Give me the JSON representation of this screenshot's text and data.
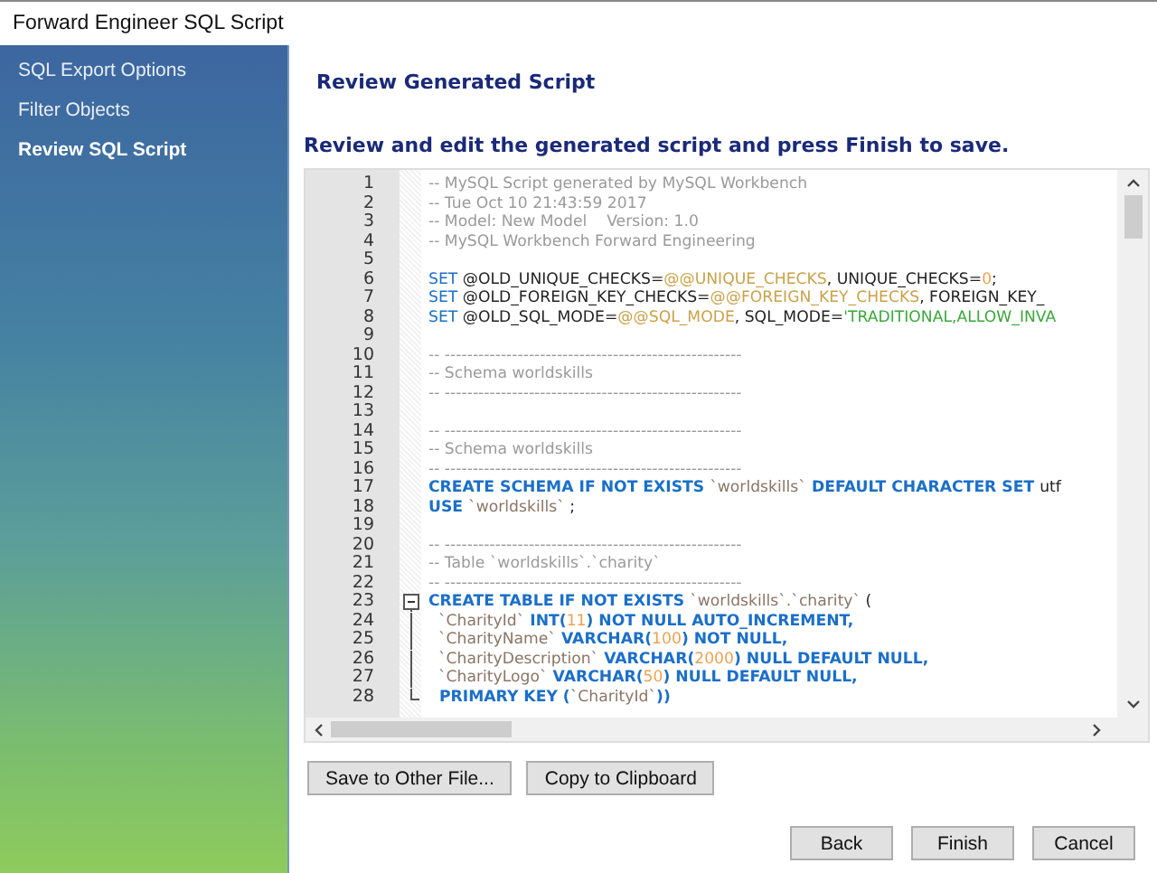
{
  "window": {
    "title": "Forward Engineer SQL Script"
  },
  "sidebar": {
    "items": [
      {
        "label": "SQL Export Options",
        "selected": false
      },
      {
        "label": "Filter Objects",
        "selected": false
      },
      {
        "label": "Review SQL Script",
        "selected": true
      }
    ]
  },
  "page": {
    "heading": "Review Generated Script",
    "instruction": "Review and edit the generated script and press Finish to save."
  },
  "editor": {
    "lines": [
      {
        "number": "1",
        "kind": "plain",
        "tokens": [
          {
            "kind": "comment",
            "text": "-- MySQL Script generated by MySQL Workbench"
          }
        ]
      },
      {
        "number": "2",
        "kind": "plain",
        "tokens": [
          {
            "kind": "comment",
            "text": "-- Tue Oct 10 21:43:59 2017"
          }
        ]
      },
      {
        "number": "3",
        "kind": "plain",
        "tokens": [
          {
            "kind": "comment",
            "text": "-- Model: New Model    Version: 1.0"
          }
        ]
      },
      {
        "number": "4",
        "kind": "plain",
        "tokens": [
          {
            "kind": "comment",
            "text": "-- MySQL Workbench Forward Engineering"
          }
        ]
      },
      {
        "number": "5",
        "kind": "plain"
      },
      {
        "number": "6",
        "kind": "plain",
        "tokens": [
          {
            "kind": "command",
            "text": "SET"
          },
          {
            "kind": "text",
            "text": " @OLD_UNIQUE_CHECKS="
          },
          {
            "kind": "variable",
            "text": "@@UNIQUE_CHECKS"
          },
          {
            "kind": "text",
            "text": ", UNIQUE_CHECKS="
          },
          {
            "kind": "number",
            "text": "0"
          },
          {
            "kind": "text",
            "text": ";"
          }
        ]
      },
      {
        "number": "7",
        "kind": "plain",
        "tokens": [
          {
            "kind": "command",
            "text": "SET"
          },
          {
            "kind": "text",
            "text": " @OLD_FOREIGN_KEY_CHECKS="
          },
          {
            "kind": "variable",
            "text": "@@FOREIGN_KEY_CHECKS"
          },
          {
            "kind": "text",
            "text": ", FOREIGN_KEY_"
          }
        ]
      },
      {
        "number": "8",
        "kind": "plain",
        "tokens": [
          {
            "kind": "command",
            "text": "SET"
          },
          {
            "kind": "text",
            "text": " @OLD_SQL_MODE="
          },
          {
            "kind": "variable",
            "text": "@@SQL_MODE"
          },
          {
            "kind": "text",
            "text": ", SQL_MODE="
          },
          {
            "kind": "string",
            "text": "'TRADITIONAL,ALLOW_INVA"
          }
        ]
      },
      {
        "number": "9",
        "kind": "plain"
      },
      {
        "number": "10",
        "kind": "plain",
        "tokens": [
          {
            "kind": "comment",
            "text": "-- -----------------------------------------------------"
          }
        ]
      },
      {
        "number": "11",
        "kind": "plain",
        "tokens": [
          {
            "kind": "comment",
            "text": "-- Schema worldskills"
          }
        ]
      },
      {
        "number": "12",
        "kind": "plain",
        "tokens": [
          {
            "kind": "comment",
            "text": "-- -----------------------------------------------------"
          }
        ]
      },
      {
        "number": "13",
        "kind": "plain"
      },
      {
        "number": "14",
        "kind": "plain",
        "tokens": [
          {
            "kind": "comment",
            "text": "-- -----------------------------------------------------"
          }
        ]
      },
      {
        "number": "15",
        "kind": "plain",
        "tokens": [
          {
            "kind": "comment",
            "text": "-- Schema worldskills"
          }
        ]
      },
      {
        "number": "16",
        "kind": "plain",
        "tokens": [
          {
            "kind": "comment",
            "text": "-- -----------------------------------------------------"
          }
        ]
      },
      {
        "number": "17",
        "kind": "plain",
        "tokens": [
          {
            "kind": "keyword",
            "text": "CREATE SCHEMA IF NOT EXISTS "
          },
          {
            "kind": "identifier",
            "text": "`worldskills`"
          },
          {
            "kind": "keyword",
            "text": " DEFAULT CHARACTER SET "
          },
          {
            "kind": "text",
            "text": "utf"
          }
        ]
      },
      {
        "number": "18",
        "kind": "plain",
        "tokens": [
          {
            "kind": "keyword",
            "text": "USE "
          },
          {
            "kind": "identifier",
            "text": "`worldskills`"
          },
          {
            "kind": "text",
            "text": " ;"
          }
        ]
      },
      {
        "number": "19",
        "kind": "plain"
      },
      {
        "number": "20",
        "kind": "plain",
        "tokens": [
          {
            "kind": "comment",
            "text": "-- -----------------------------------------------------"
          }
        ]
      },
      {
        "number": "21",
        "kind": "plain",
        "tokens": [
          {
            "kind": "comment",
            "text": "-- Table `worldskills`.`charity`"
          }
        ]
      },
      {
        "number": "22",
        "kind": "plain",
        "tokens": [
          {
            "kind": "comment",
            "text": "-- -----------------------------------------------------"
          }
        ]
      },
      {
        "number": "23",
        "kind": "fold_start",
        "tokens": [
          {
            "kind": "keyword",
            "text": "CREATE TABLE IF NOT EXISTS "
          },
          {
            "kind": "identifier",
            "text": "`worldskills`.`charity`"
          },
          {
            "kind": "text",
            "text": " ("
          }
        ]
      },
      {
        "number": "24",
        "kind": "fold_body",
        "tokens": [
          {
            "kind": "identifier",
            "text": "  `CharityId`"
          },
          {
            "kind": "keyword",
            "text": " INT("
          },
          {
            "kind": "number",
            "text": "11"
          },
          {
            "kind": "keyword",
            "text": ") NOT NULL AUTO_INCREMENT,"
          }
        ]
      },
      {
        "number": "25",
        "kind": "fold_body",
        "tokens": [
          {
            "kind": "identifier",
            "text": "  `CharityName`"
          },
          {
            "kind": "keyword",
            "text": " VARCHAR("
          },
          {
            "kind": "number",
            "text": "100"
          },
          {
            "kind": "keyword",
            "text": ") NOT NULL,"
          }
        ]
      },
      {
        "number": "26",
        "kind": "fold_body",
        "tokens": [
          {
            "kind": "identifier",
            "text": "  `CharityDescription`"
          },
          {
            "kind": "keyword",
            "text": " VARCHAR("
          },
          {
            "kind": "number",
            "text": "2000"
          },
          {
            "kind": "keyword",
            "text": ") NULL DEFAULT NULL,"
          }
        ]
      },
      {
        "number": "27",
        "kind": "fold_body",
        "tokens": [
          {
            "kind": "identifier",
            "text": "  `CharityLogo`"
          },
          {
            "kind": "keyword",
            "text": " VARCHAR("
          },
          {
            "kind": "number",
            "text": "50"
          },
          {
            "kind": "keyword",
            "text": ") NULL DEFAULT NULL,"
          }
        ]
      },
      {
        "number": "28",
        "kind": "fold_end",
        "tokens": [
          {
            "kind": "keyword",
            "text": "  PRIMARY KEY ("
          },
          {
            "kind": "identifier",
            "text": "`CharityId`"
          },
          {
            "kind": "keyword",
            "text": "))"
          }
        ]
      }
    ]
  },
  "file_buttons": [
    "Save to Other File...",
    "Copy to Clipboard"
  ],
  "nav_buttons": [
    "Back",
    "Finish",
    "Cancel"
  ]
}
